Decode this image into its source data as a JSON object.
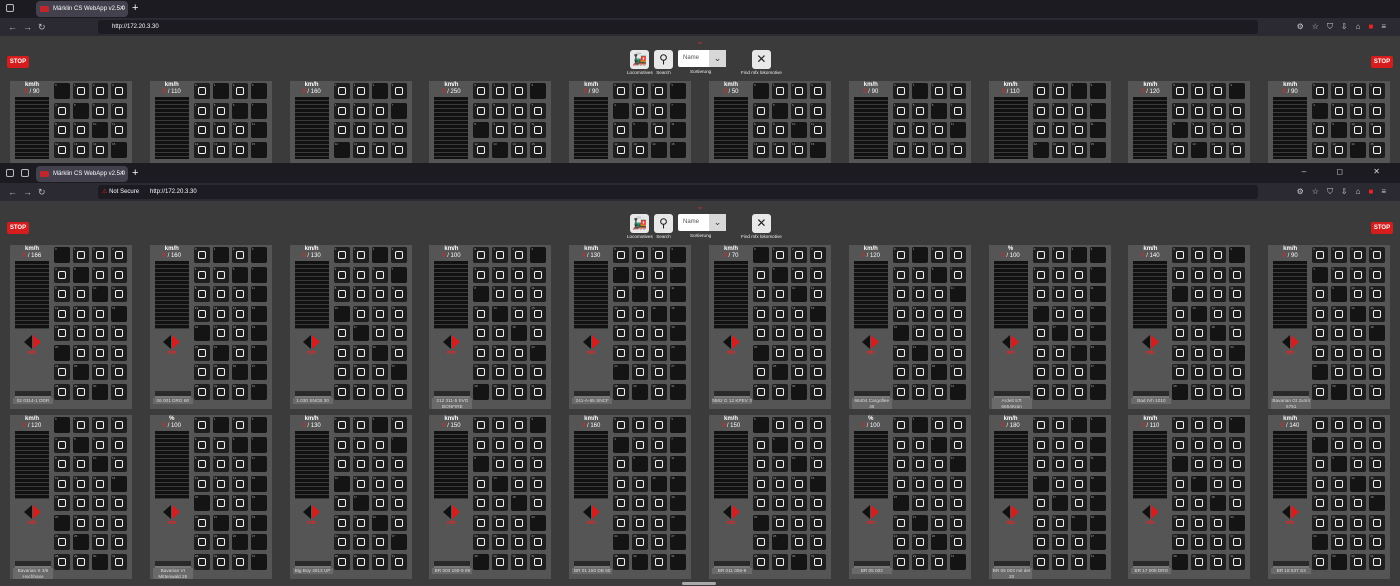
{
  "browser_back": {
    "tab_title": "Märklin CS WebApp v2.5.0",
    "url": "http://172.20.3.30",
    "new_tab": "+",
    "close_tab": "×"
  },
  "browser_front": {
    "tab_title": "Märklin CS WebApp v2.5.0",
    "url": "http://172.20.3.30",
    "security": "Not Secure",
    "new_tab": "+",
    "close_tab": "×",
    "window_controls": "–  ◻  ✕"
  },
  "app": {
    "stop_label": "STOP",
    "toolbar": {
      "locomotives": "Locomotives",
      "search": "Search",
      "sort_value": "Name",
      "sort_label": "Sortierung",
      "find_mfx": "Find mfx lokomotive"
    },
    "accent": "#d61d1d"
  },
  "back_locos": [
    {
      "unit": "km/h",
      "speed": "0 / 90"
    },
    {
      "unit": "km/h",
      "speed": "0 / 110"
    },
    {
      "unit": "km/h",
      "speed": "0 / 160"
    },
    {
      "unit": "km/h",
      "speed": "0 / 250"
    },
    {
      "unit": "km/h",
      "speed": "0 / 90"
    },
    {
      "unit": "km/h",
      "speed": "0 / 50"
    },
    {
      "unit": "km/h",
      "speed": "0 / 90"
    },
    {
      "unit": "km/h",
      "speed": "0 / 110"
    },
    {
      "unit": "km/h",
      "speed": "0 / 120"
    },
    {
      "unit": "km/h",
      "speed": "0 / 90"
    }
  ],
  "locos_row1": [
    {
      "unit": "km/h",
      "speed": "0 / 166",
      "name": "02 0314-1 DDR"
    },
    {
      "unit": "km/h",
      "speed": "0 / 160",
      "name": "06 001 DRG 60"
    },
    {
      "unit": "km/h",
      "speed": "0 / 130",
      "name": "1.030 SNCB 30"
    },
    {
      "unit": "km/h",
      "speed": "0 / 100",
      "name": "212 311-5 SVG BONFIRE"
    },
    {
      "unit": "km/h",
      "speed": "0 / 130",
      "name": "241-A-65 SNCF"
    },
    {
      "unit": "km/h",
      "speed": "0 / 70",
      "name": "5582 G 12 KPEV 3"
    },
    {
      "unit": "km/h",
      "speed": "0 / 120",
      "name": "66404 Cargoflee 40"
    },
    {
      "unit": "%",
      "speed": "0 / 100",
      "name": "Ardelt 57t 6664Kran"
    },
    {
      "unit": "km/h",
      "speed": "0 / 140",
      "name": "Bad IVh 1010"
    },
    {
      "unit": "km/h",
      "speed": "0 / 90",
      "name": "Bavarian Gt 2x4/4 5751"
    }
  ],
  "locos_row2": [
    {
      "unit": "km/h",
      "speed": "0 / 120",
      "name": "Bavarian S 3/6 Hochhaxe"
    },
    {
      "unit": "%",
      "speed": "0 / 100",
      "name": "Bavarian VI Mittenwald 26"
    },
    {
      "unit": "km/h",
      "speed": "0 / 130",
      "name": "Big Boy 4013 UP"
    },
    {
      "unit": "km/h",
      "speed": "0 / 150",
      "name": "BR 003 160-9 09"
    },
    {
      "unit": "km/h",
      "speed": "0 / 160",
      "name": "BR 01 150 DB 50"
    },
    {
      "unit": "km/h",
      "speed": "0 / 150",
      "name": "BR 011 056-9"
    },
    {
      "unit": "%",
      "speed": "0 / 100",
      "name": "BR 05 002"
    },
    {
      "unit": "km/h",
      "speed": "0 / 180",
      "name": "BR 05 003 mit der 20"
    },
    {
      "unit": "km/h",
      "speed": "0 / 110",
      "name": "BR 17 008 DRG"
    },
    {
      "unit": "km/h",
      "speed": "0 / 140",
      "name": "BR 18 537 S3"
    }
  ],
  "mfx_label": "mfx"
}
